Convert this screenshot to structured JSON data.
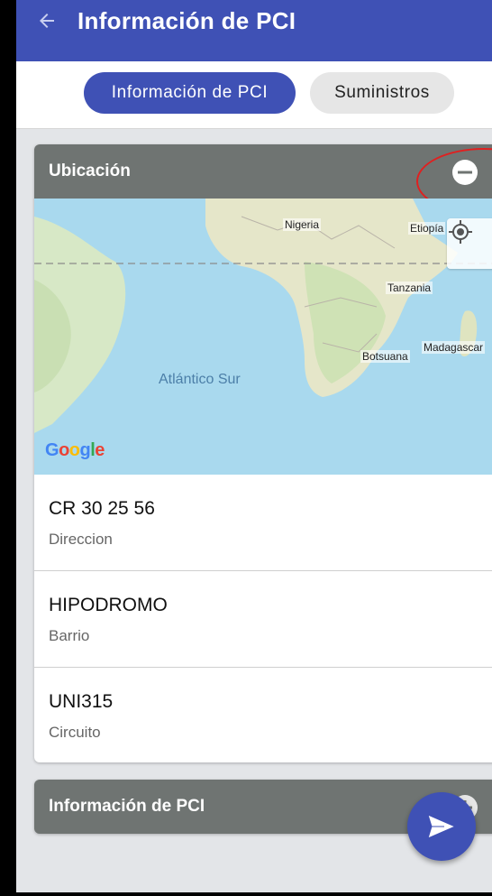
{
  "appbar": {
    "title": "Información de PCI",
    "back_icon": "arrow-left-icon",
    "color": "#3f51b5"
  },
  "tabs": [
    {
      "label": "Información de PCI",
      "active": true
    },
    {
      "label": "Suministros",
      "active": false
    }
  ],
  "location_card": {
    "title": "Ubicación",
    "toggle_icon": "minus-circle-icon",
    "map": {
      "labels": {
        "nigeria": "Nigeria",
        "etiopia": "Etiopía",
        "tanzania": "Tanzania",
        "botsuana": "Botsuana",
        "madagascar": "Madagascar",
        "ocean": "Atlántico Sur"
      },
      "logo": "Google",
      "locate_icon": "my-location-icon"
    },
    "fields": [
      {
        "value": "CR 30 25 56",
        "label": "Direccion"
      },
      {
        "value": "HIPODROMO",
        "label": "Barrio"
      },
      {
        "value": "UNI315",
        "label": "Circuito"
      }
    ]
  },
  "pci_card": {
    "title": "Información de PCI",
    "toggle_icon": "plus-circle-icon"
  },
  "fab": {
    "icon": "send-icon"
  }
}
